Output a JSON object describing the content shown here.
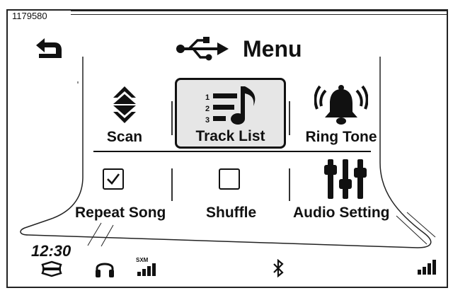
{
  "reference": {
    "number": "1179580"
  },
  "header": {
    "title": "Menu",
    "usb_icon": "usb-icon",
    "back_icon": "back-arrow-icon"
  },
  "menu": {
    "items": [
      {
        "label": "Scan",
        "icon": "scan-updown-icon",
        "selected": false
      },
      {
        "label": "Track List",
        "icon": "track-list-icon",
        "selected": true
      },
      {
        "label": "Ring Tone",
        "icon": "ring-bell-icon",
        "selected": false
      },
      {
        "label": "Repeat Song",
        "icon": "checkbox",
        "checked": true
      },
      {
        "label": "Shuffle",
        "icon": "checkbox",
        "checked": false
      },
      {
        "label": "Audio Setting",
        "icon": "equalizer-sliders-icon"
      }
    ]
  },
  "status": {
    "time": "12:30",
    "icons": [
      "motorcycle-brand-icon",
      "headphones-icon",
      "sxm-signal-icon",
      "bluetooth-icon",
      "cellular-signal-icon"
    ],
    "sxm_label": "SXM"
  }
}
